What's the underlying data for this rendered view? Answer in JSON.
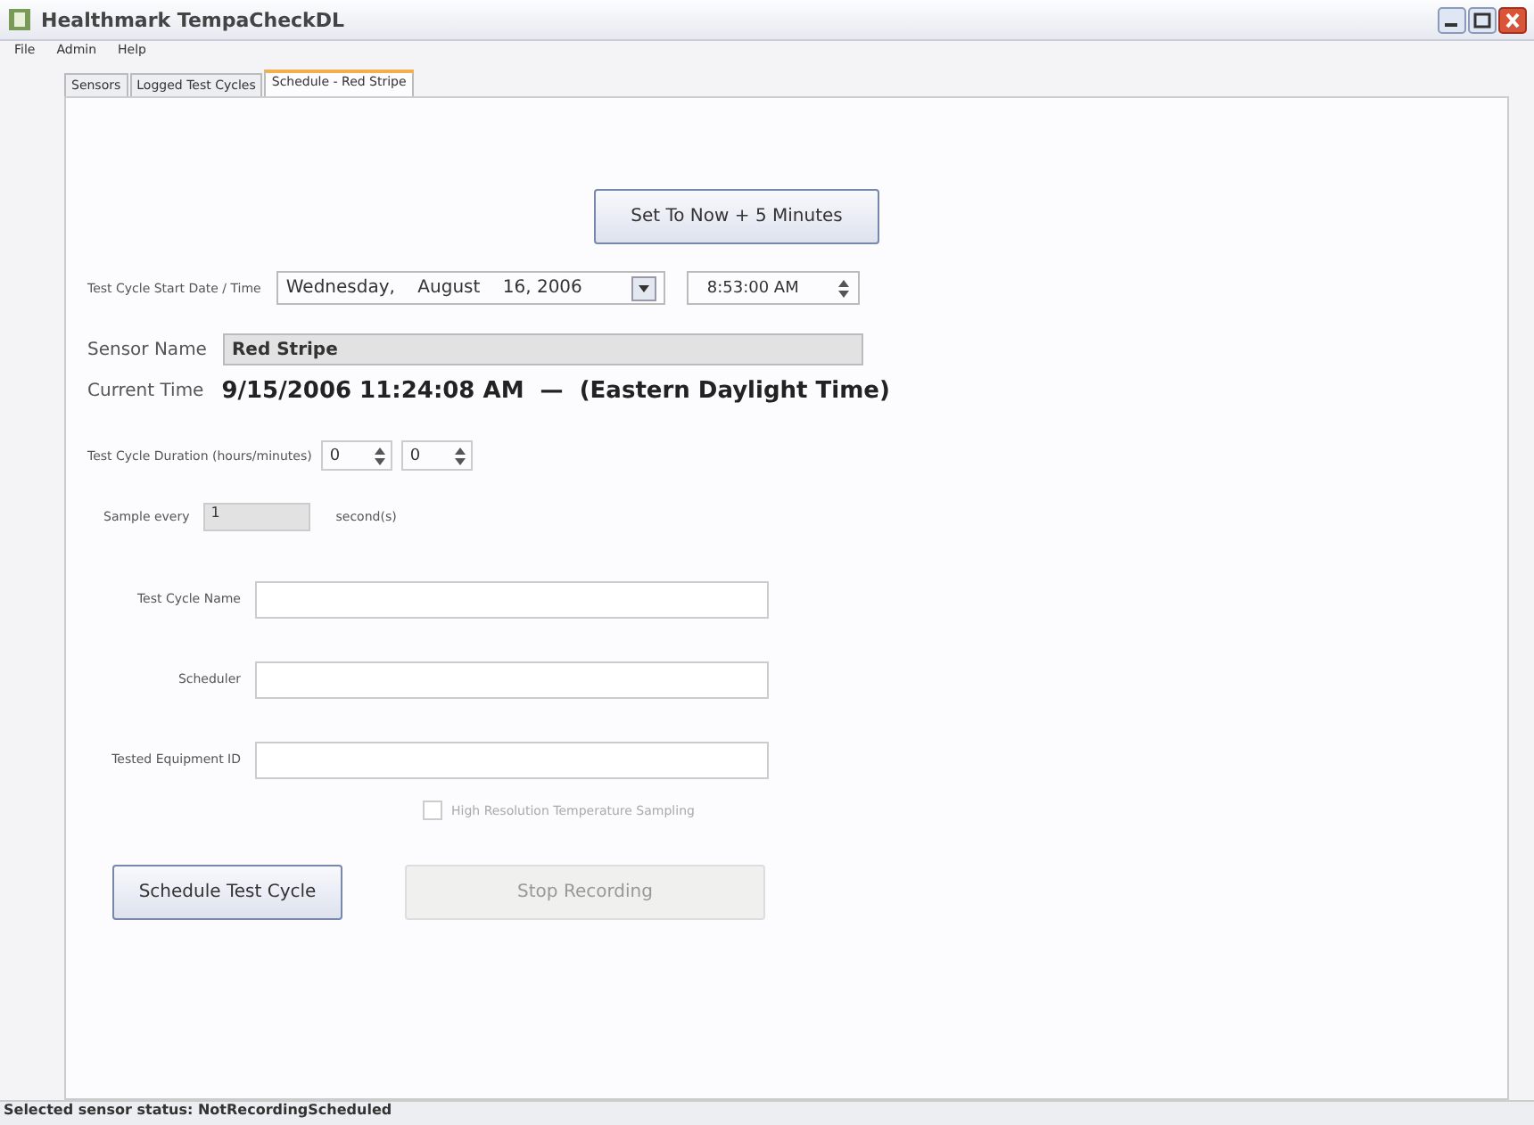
{
  "window": {
    "title": "Healthmark TempaCheckDL"
  },
  "menu": [
    "File",
    "Admin",
    "Help"
  ],
  "tabs": [
    {
      "label": "Sensors",
      "selected": false
    },
    {
      "label": "Logged Test Cycles",
      "selected": false
    },
    {
      "label": "Schedule - Red Stripe",
      "selected": true
    }
  ],
  "set_now_button": "Set To Now + 5 Minutes",
  "start": {
    "label": "Test Cycle Start Date / Time",
    "date": "Wednesday,    August    16, 2006",
    "time": "8:53:00 AM"
  },
  "sensor_name": {
    "label": "Sensor Name",
    "value": "Red Stripe"
  },
  "current_time": {
    "label": "Current Time",
    "value": "9/15/2006 11:24:08 AM  —  (Eastern Daylight Time)"
  },
  "duration": {
    "label": "Test Cycle Duration (hours/minutes)",
    "hours": "0",
    "minutes": "0"
  },
  "sample": {
    "label": "Sample every",
    "value": "1",
    "unit": "second(s)"
  },
  "text_fields": [
    {
      "label": "Test Cycle Name"
    },
    {
      "label": "Scheduler"
    },
    {
      "label": "Tested Equipment ID"
    }
  ],
  "high_res": {
    "label": "High Resolution Temperature Sampling",
    "checked": false,
    "disabled": true
  },
  "buttons": [
    {
      "label": "Schedule Test Cycle",
      "disabled": false
    },
    {
      "label": "Stop Recording",
      "disabled": true
    }
  ],
  "status_bar": "Selected sensor status: NotRecordingScheduled"
}
